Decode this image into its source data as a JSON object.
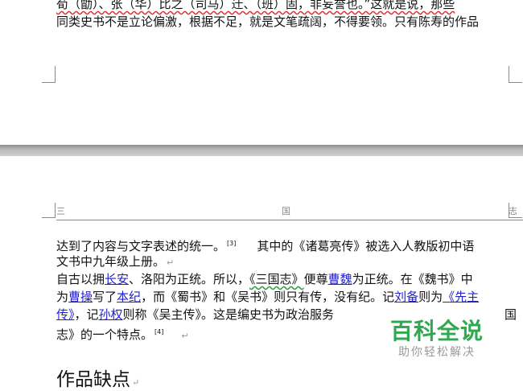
{
  "top_page": {
    "line1": "荀（勖）、张（华）比之（司马）迁、（班）固，非妄誉也。”这就是说，那些",
    "line2": "同类史书不是立论偏激，根据不足，就是文笔疏阔，不得要领。只有陈寿的作品"
  },
  "header": {
    "left": "三",
    "center": "国",
    "right": "志"
  },
  "body": {
    "p1_l1_a": "达到了内容与文字表述的统一。",
    "p1_l1_ref": "[3]",
    "p1_l1_b": "其中的《诸葛亮传》被选入人教版初中语",
    "p1_l2": "文书中九年级上册。",
    "p2_l1_a": "自古以拥",
    "p2_l1_link1": "长安",
    "p2_l1_b": "、洛阳为正统。所以，",
    "p2_l1_book": "《三国志》",
    "p2_l1_c": "便尊",
    "p2_l1_link2": "曹魏",
    "p2_l1_d": "为正统。在《魏书》中",
    "p2_l2_a": "为",
    "p2_l2_link1": "曹操",
    "p2_l2_b": "写了",
    "p2_l2_link2": "本纪",
    "p2_l2_c": "，而《蜀书》和《吴书》则只有传，没有纪。记",
    "p2_l2_link3": "刘备",
    "p2_l2_d": "则为",
    "p2_l2_link4": "《先主",
    "p2_l3_link1": "传》",
    "p2_l3_a": "，记",
    "p2_l3_link2": "孙权",
    "p2_l3_b": "则称《吴主传》。这是编史书为政治服务",
    "p2_l3_c": "国",
    "p2_l4_a": "志》的一个特点。",
    "p2_l4_ref": "[4]",
    "heading": "作品缺点"
  },
  "watermark": {
    "title": "百科全说",
    "subtitle": "助你轻松解决"
  }
}
